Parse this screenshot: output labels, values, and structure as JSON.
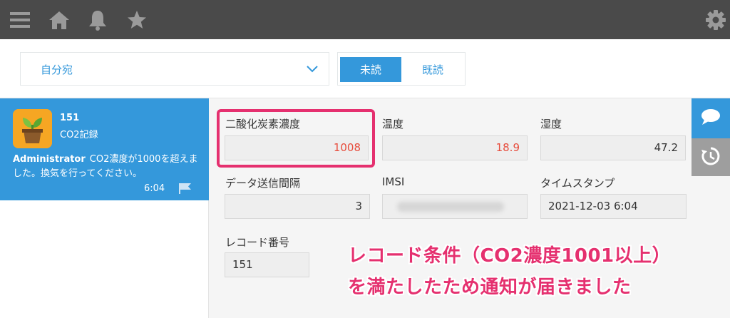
{
  "topbar": {
    "icons": [
      "menu-icon",
      "home-icon",
      "bell-icon",
      "star-icon",
      "gear-icon"
    ]
  },
  "filter": {
    "dropdown_value": "自分宛",
    "tabs": [
      {
        "label": "未読",
        "active": true
      },
      {
        "label": "既読",
        "active": false
      }
    ]
  },
  "notification": {
    "record_number": "151",
    "app_name": "CO2記録",
    "user": "Administrator",
    "message": "CO2濃度が1000を超えました。換気を行ってください。",
    "time": "6:04"
  },
  "record": {
    "co2": {
      "label": "二酸化炭素濃度",
      "value": "1008"
    },
    "temperature": {
      "label": "温度",
      "value": "18.9"
    },
    "humidity": {
      "label": "湿度",
      "value": "47.2"
    },
    "interval": {
      "label": "データ送信間隔",
      "value": "3"
    },
    "imsi": {
      "label": "IMSI",
      "value": ""
    },
    "timestamp": {
      "label": "タイムスタンプ",
      "value": "2021-12-03 6:04"
    },
    "record_no": {
      "label": "レコード番号",
      "value": "151"
    }
  },
  "annotation": {
    "line1": "レコード条件（CO2濃度1001以上）",
    "line2": "を満たしたため通知が届きました"
  },
  "colors": {
    "accent": "#3498db",
    "highlight": "#e5306f",
    "alert_value": "#e74c3c",
    "topbar": "#4a4a4a"
  }
}
